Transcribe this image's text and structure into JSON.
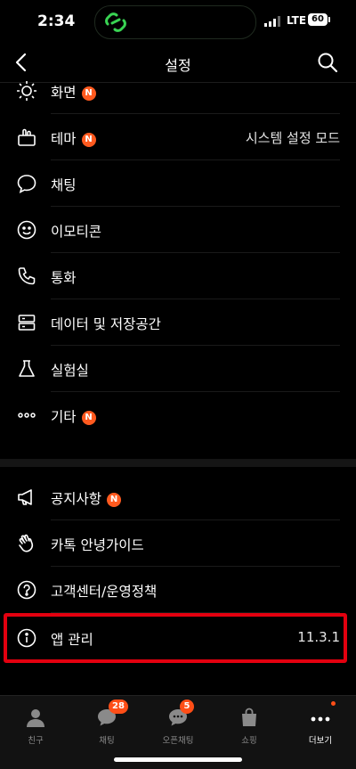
{
  "status": {
    "time": "2:34",
    "network": "LTE",
    "battery": "60"
  },
  "header": {
    "title": "설정"
  },
  "menu": [
    {
      "label": "화면",
      "badge": "N"
    },
    {
      "label": "테마",
      "badge": "N",
      "value": "시스템 설정 모드"
    },
    {
      "label": "채팅"
    },
    {
      "label": "이모티콘"
    },
    {
      "label": "통화"
    },
    {
      "label": "데이터 및 저장공간"
    },
    {
      "label": "실험실"
    },
    {
      "label": "기타",
      "badge": "N"
    }
  ],
  "menu2": [
    {
      "label": "공지사항",
      "badge": "N"
    },
    {
      "label": "카톡 안녕가이드"
    },
    {
      "label": "고객센터/운영정책"
    },
    {
      "label": "앱 관리",
      "value": "11.3.1"
    }
  ],
  "tabs": [
    {
      "label": "친구"
    },
    {
      "label": "채팅",
      "badge": "28"
    },
    {
      "label": "오픈채팅",
      "badge": "5"
    },
    {
      "label": "쇼핑"
    },
    {
      "label": "더보기"
    }
  ],
  "colors": {
    "badge": "#ff5a1f",
    "highlight": "#e3000f"
  }
}
